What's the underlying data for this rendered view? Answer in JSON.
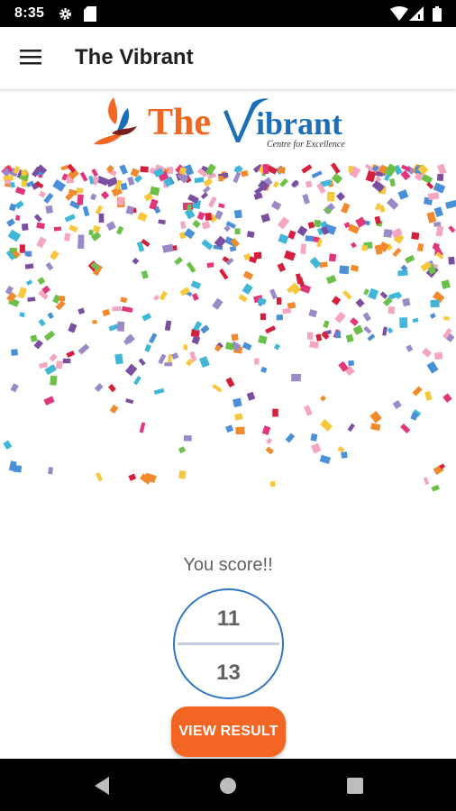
{
  "status_bar": {
    "time": "8:35",
    "icons": [
      "settings-icon",
      "sd-card-icon",
      "wifi-icon",
      "signal-icon",
      "battery-icon"
    ]
  },
  "app_bar": {
    "menu_icon": "hamburger-menu-icon",
    "title": "The Vibrant"
  },
  "logo": {
    "brand_part1": "The ",
    "brand_part2": "ibrant",
    "tagline": "Centre for Excellence",
    "colors": {
      "orange": "#f26522",
      "blue": "#1b6fb8"
    }
  },
  "result": {
    "label": "You score!!",
    "score": "11",
    "total": "13",
    "button_label": "VIEW RESULT"
  },
  "nav_bar": {
    "icons": [
      "back-icon",
      "home-icon",
      "recents-icon"
    ]
  },
  "colors": {
    "accent": "#f26522",
    "circle_border": "#2f77c6",
    "text_gray": "#616161"
  }
}
